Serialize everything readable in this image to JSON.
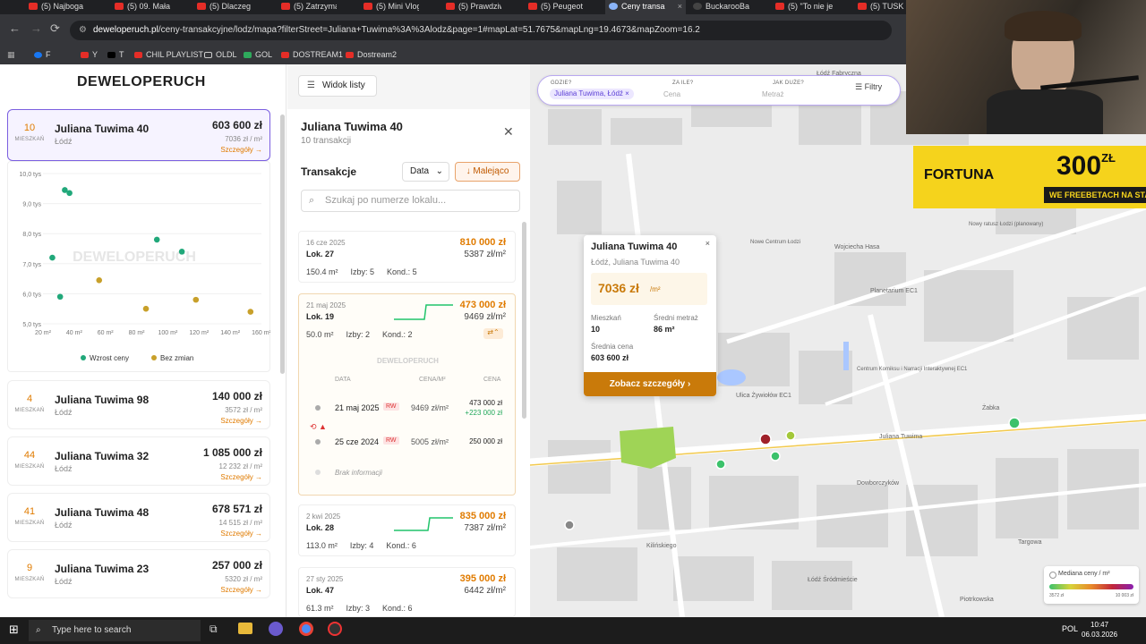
{
  "browser": {
    "tabs": [
      {
        "title": "(5) Najboga"
      },
      {
        "title": "(5) 09. Mała"
      },
      {
        "title": "(5) Dlaczeg"
      },
      {
        "title": "(5) Zatrzyma"
      },
      {
        "title": "(5) Mini Vlog"
      },
      {
        "title": "(5) Prawdziw"
      },
      {
        "title": "(5) Peugeot"
      },
      {
        "title": "Ceny transa"
      },
      {
        "title": "BuckarooBa"
      },
      {
        "title": "(5) \"To nie je"
      },
      {
        "title": "(5) TUSK W"
      }
    ],
    "url_domain": "deweloperuch.pl",
    "url_path": "/ceny-transakcyjne/lodz/mapa?filterStreet=Juliana+Tuwima%3A%3Alodz&page=1#mapLat=51.7675&mapLng=19.4673&mapZoom=16.2",
    "bookmarks": [
      "F",
      "Y",
      "T",
      "CHIL PLAYLIST",
      "OLDL",
      "GOL",
      "DOSTREAM1",
      "Dostream2"
    ]
  },
  "site": {
    "logo": "DEWELOPERUCH",
    "watermark": "DEWELOPERUCH"
  },
  "list": {
    "count_label": "MIESZKAŃ",
    "details_link": "Szczegóły →",
    "items": [
      {
        "count": "10",
        "name": "Juliana Tuwima 40",
        "city": "Łódź",
        "price": "603 600 zł",
        "per_m2": "7036 zł / m²"
      },
      {
        "count": "4",
        "name": "Juliana Tuwima 98",
        "city": "Łódź",
        "price": "140 000 zł",
        "per_m2": "3572 zł / m²"
      },
      {
        "count": "44",
        "name": "Juliana Tuwima 32",
        "city": "Łódź",
        "price": "1 085 000 zł",
        "per_m2": "12 232 zł / m²"
      },
      {
        "count": "41",
        "name": "Juliana Tuwima 48",
        "city": "Łódź",
        "price": "678 571 zł",
        "per_m2": "14 515 zł / m²"
      },
      {
        "count": "9",
        "name": "Juliana Tuwima 23",
        "city": "Łódź",
        "price": "257 000 zł",
        "per_m2": "5320 zł / m²"
      }
    ]
  },
  "chart_data": {
    "type": "scatter",
    "y_ticks": [
      "10,0 tys",
      "9,0 tys",
      "8,0 tys",
      "7,0 tys",
      "6,0 tys",
      "5,0 tys"
    ],
    "x_ticks": [
      "20 m²",
      "40 m²",
      "60 m²",
      "80 m²",
      "100 m²",
      "120 m²",
      "140 m²",
      "160 m²"
    ],
    "xlim": [
      20,
      160
    ],
    "ylim": [
      5.0,
      10.0
    ],
    "series": [
      {
        "name": "Wzrost ceny",
        "color": "#21a87a",
        "points": [
          [
            34,
            9.45
          ],
          [
            37,
            9.35
          ],
          [
            26,
            7.2
          ],
          [
            31,
            5.9
          ],
          [
            93,
            7.8
          ],
          [
            109,
            7.4
          ]
        ]
      },
      {
        "name": "Bez zmian",
        "color": "#c8a02a",
        "points": [
          [
            56,
            6.45
          ],
          [
            86,
            5.5
          ],
          [
            118,
            5.8
          ],
          [
            153,
            5.4
          ]
        ]
      }
    ]
  },
  "middle": {
    "view_list_button": "Widok listy",
    "title": "Juliana Tuwima 40",
    "subtitle": "10 transakcji",
    "section": "Transakcje",
    "sort_field": "Data",
    "sort_order": "↓ Malejąco",
    "search_placeholder": "Szukaj po numerze lokalu...",
    "history_headers": [
      "DATA",
      "CENA/M²",
      "CENA"
    ],
    "history_rows": [
      {
        "date": "21 maj 2025",
        "tag": "RW",
        "per_m2": "9469 zł/m²",
        "price": "473 000 zł",
        "delta": "+223 000 zł"
      },
      {
        "date": "25 cze 2024",
        "tag": "RW",
        "per_m2": "5005 zł/m²",
        "price": "250 000 zł",
        "delta": ""
      }
    ],
    "no_info": "Brak informacji",
    "transactions": [
      {
        "date": "16 cze 2025",
        "lok": "Lok. 27",
        "price": "810 000 zł",
        "per_m2": "5387 zł/m²",
        "area": "150.4 m²",
        "rooms": "Izby: 5",
        "cond": "Kond.: 5"
      },
      {
        "date": "21 maj 2025",
        "lok": "Lok. 19",
        "price": "473 000 zł",
        "per_m2": "9469 zł/m²",
        "area": "50.0 m²",
        "rooms": "Izby: 2",
        "cond": "Kond.: 2"
      },
      {
        "date": "2 kwi 2025",
        "lok": "Lok. 28",
        "price": "835 000 zł",
        "per_m2": "7387 zł/m²",
        "area": "113.0 m²",
        "rooms": "Izby: 4",
        "cond": "Kond.: 6"
      },
      {
        "date": "27 sty 2025",
        "lok": "Lok. 47",
        "price": "395 000 zł",
        "per_m2": "6442 zł/m²",
        "area": "61.3 m²",
        "rooms": "Izby: 3",
        "cond": "Kond.: 6"
      }
    ]
  },
  "map": {
    "search": {
      "where_label": "GDZIE?",
      "where_chip": "Juliana Tuwima, Łódź",
      "price_label": "ZA ILE?",
      "price_placeholder": "Cena",
      "size_label": "JAK DUŻE?",
      "size_placeholder": "Metraż",
      "filters": "Filtry"
    },
    "popup": {
      "title": "Juliana Tuwima 40",
      "address": "Łódź, Juliana Tuwima 40",
      "price_m2": "7036 zł",
      "price_m2_unit": "/m²",
      "flats_label": "Mieszkań",
      "flats": "10",
      "area_label": "Średni metraż",
      "area": "86 m²",
      "avg_label": "Średnia cena",
      "avg": "603 600 zł",
      "button": "Zobacz szczegóły"
    },
    "labels": [
      "Łódź Fabryczna",
      "Nowe Centrum Łodzi",
      "Wojciecha Hasa",
      "Nowy ratusz Łodzi (planowany)",
      "Planetarium EC1",
      "Ulica Żywiołów EC1",
      "Juliana Tuwima",
      "Żabka",
      "Kilińskiego",
      "Łódź Śródmieście",
      "Targowa",
      "Dowborczyków",
      "Piotrkowska",
      "Centrum Komiksu i Narracji Interaktywnej EC1"
    ],
    "legend_title": "Mediana ceny / m²",
    "legend_min": "3572 zł",
    "legend_max": "10 003 zł"
  },
  "ads": {
    "brand": "FORTUNA",
    "amount": "300",
    "currency": "ZŁ",
    "tagline": "WE FREEBETACH NA STA"
  },
  "taskbar": {
    "search": "Type here to search",
    "lang": "POL",
    "time": "10:47",
    "date": "06.03.2026"
  }
}
